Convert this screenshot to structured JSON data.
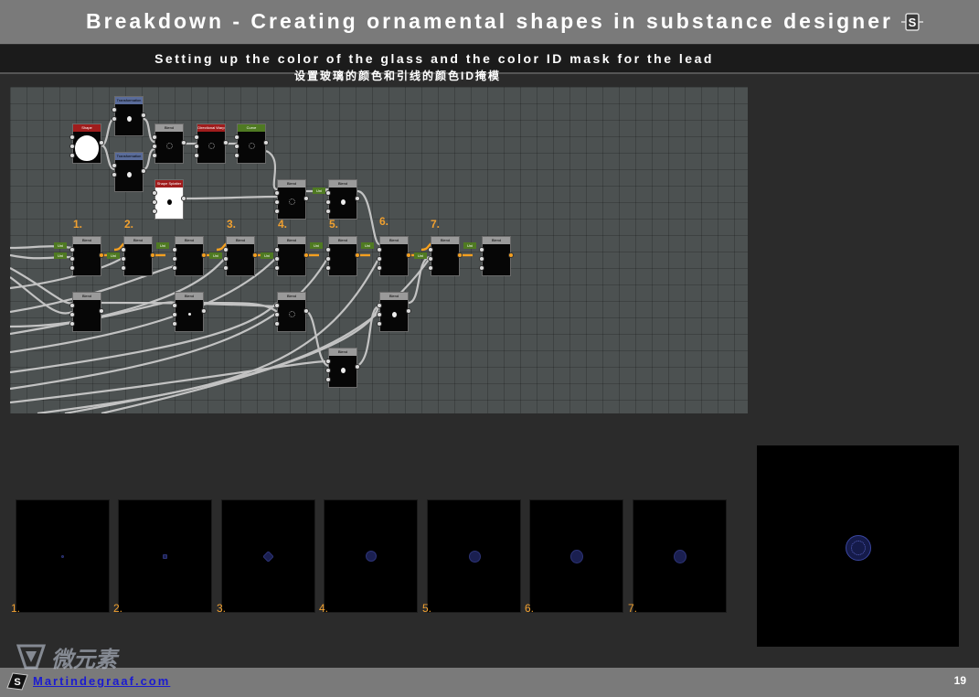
{
  "header": {
    "title": "Breakdown - Creating ornamental shapes in substance designer",
    "logo_icon": "substance-designer-logo"
  },
  "subtitle": {
    "english": "Setting up the color of the glass and the color ID mask for the lead",
    "chinese": "设置玻璃的颜色和引线的颜色ID掩模"
  },
  "graph": {
    "background": "#4c5151",
    "step_numbers": [
      "1.",
      "2.",
      "3.",
      "4.",
      "5.",
      "6.",
      "7."
    ],
    "nodes": [
      {
        "label": "Shape",
        "style": "red"
      },
      {
        "label": "Transformation 2D",
        "style": "blue"
      },
      {
        "label": "Transformation 2D",
        "style": "blue"
      },
      {
        "label": "Blend",
        "style": "grey"
      },
      {
        "label": "Blend",
        "style": "grey"
      },
      {
        "label": "Shape Splatter",
        "style": "red"
      },
      {
        "label": "Directional Warp",
        "style": "red"
      },
      {
        "label": "Curve",
        "style": "green"
      }
    ],
    "accent_connection": "#f5a020",
    "value_tag": "Uni"
  },
  "progress": {
    "labels": [
      "1.",
      "2.",
      "3.",
      "4.",
      "5.",
      "6.",
      "7."
    ]
  },
  "footer": {
    "link": "Martindegraaf.com",
    "page_number": "19",
    "watermark": "微元素",
    "logo_icon": "substance-logo"
  },
  "colors": {
    "accent_orange": "#f0a030",
    "link_blue": "#1b1bd0",
    "bar_grey": "#7a7a7a"
  }
}
